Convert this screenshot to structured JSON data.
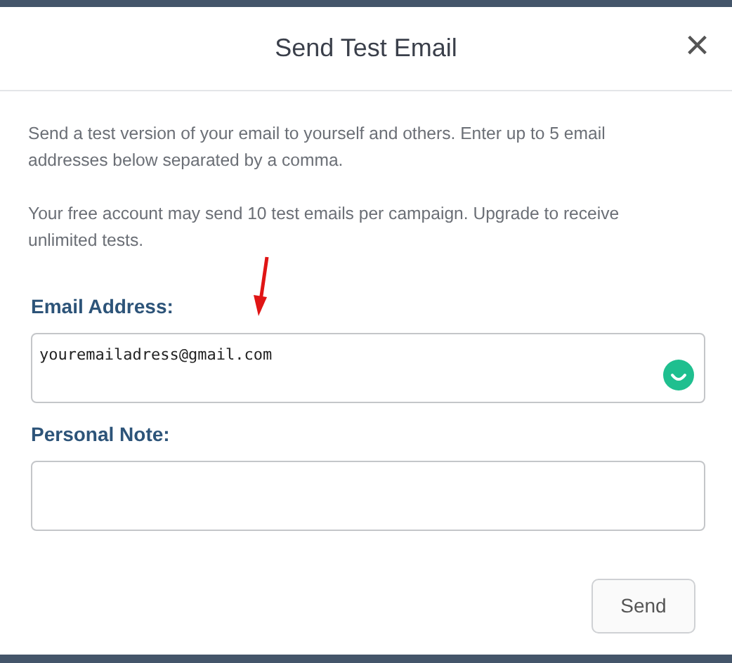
{
  "dialog": {
    "title": "Send Test Email",
    "close": "×"
  },
  "intro": [
    "Send a test version of your email to yourself and others. Enter up to 5 email addresses below separated by a comma.",
    "Your free account may send 10 test emails per campaign. Upgrade to receive unlimited tests."
  ],
  "fields": [
    {
      "label": "Email Address:",
      "value": "youremailadress@gmail.com",
      "assistant_icon": true
    },
    {
      "label": "Personal Note:",
      "assistant_icon": false
    }
  ],
  "buttons": [
    "Send"
  ]
}
